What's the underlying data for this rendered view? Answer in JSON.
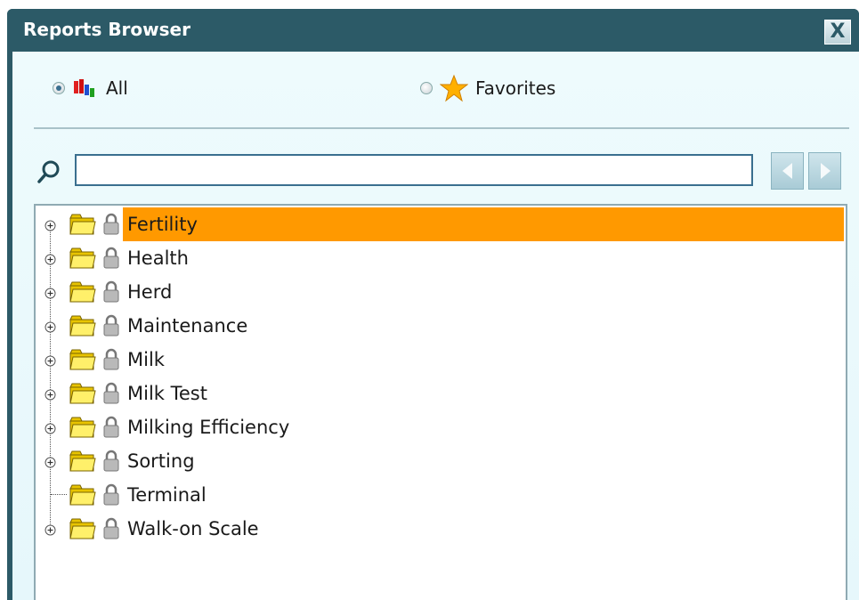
{
  "window": {
    "title": "Reports Browser",
    "close_label": "X"
  },
  "filters": {
    "all_label": "All",
    "favorites_label": "Favorites",
    "selected": "All"
  },
  "search": {
    "value": "",
    "placeholder": ""
  },
  "tree": {
    "items": [
      {
        "label": "Fertility",
        "expandable": true,
        "selected": true
      },
      {
        "label": "Health",
        "expandable": true,
        "selected": false
      },
      {
        "label": "Herd",
        "expandable": true,
        "selected": false
      },
      {
        "label": "Maintenance",
        "expandable": true,
        "selected": false
      },
      {
        "label": "Milk",
        "expandable": true,
        "selected": false
      },
      {
        "label": "Milk Test",
        "expandable": true,
        "selected": false
      },
      {
        "label": "Milking Efficiency",
        "expandable": true,
        "selected": false
      },
      {
        "label": "Sorting",
        "expandable": true,
        "selected": false
      },
      {
        "label": "Terminal",
        "expandable": false,
        "selected": false
      },
      {
        "label": "Walk-on Scale",
        "expandable": true,
        "selected": false
      }
    ]
  },
  "colors": {
    "titlebar": "#2c5a67",
    "selection": "#ff9900",
    "background": "#eefbfd"
  }
}
